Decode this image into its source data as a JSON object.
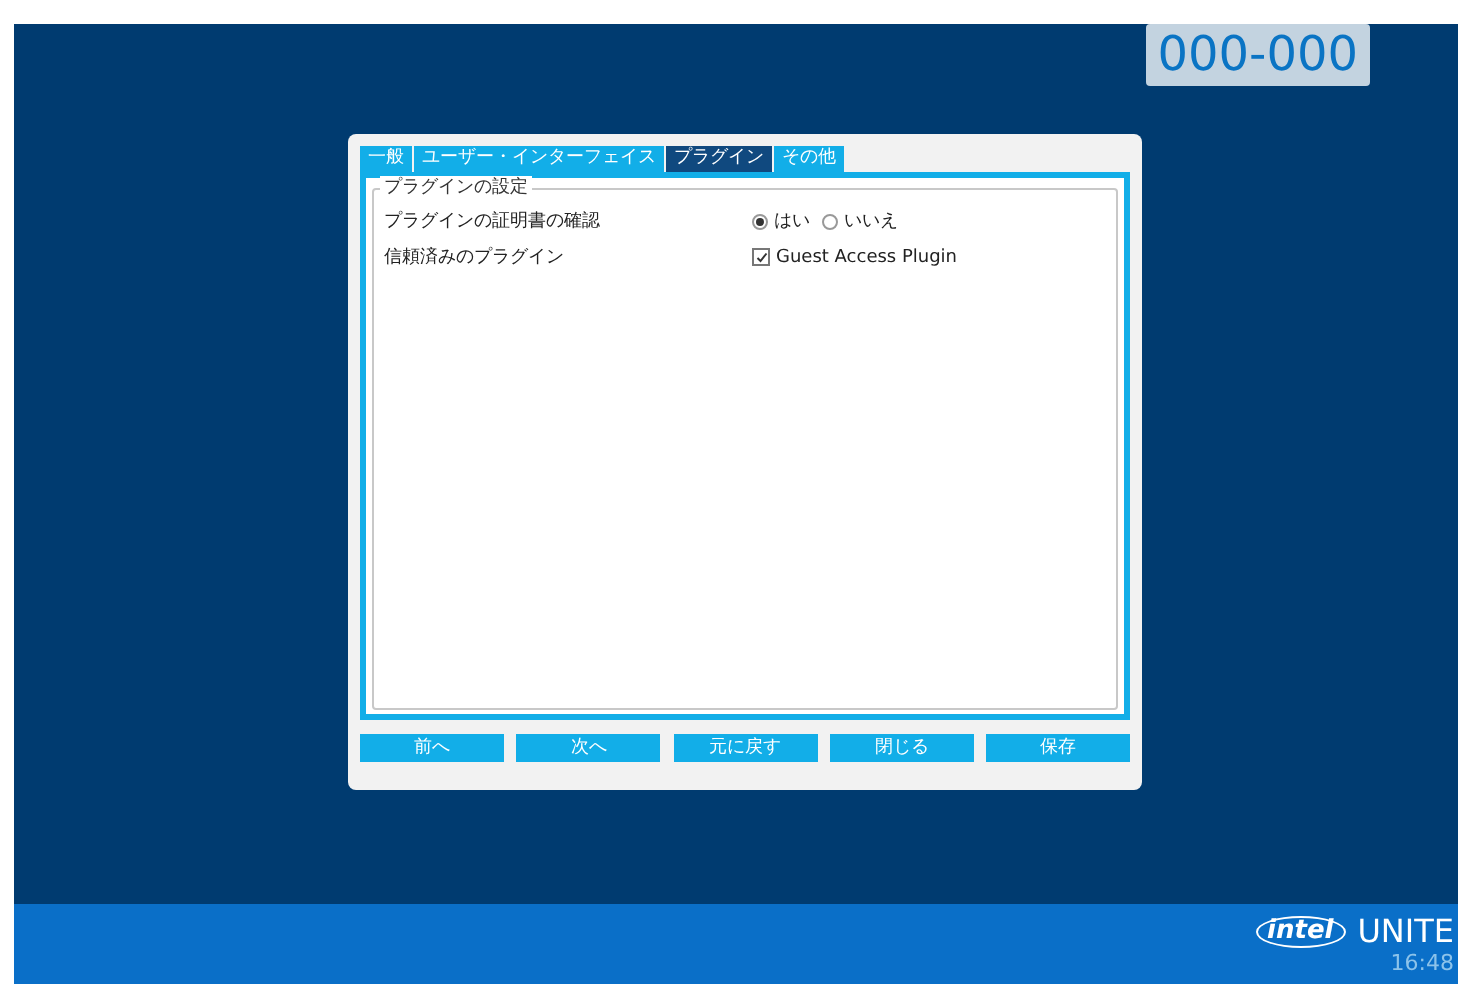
{
  "code": "000-000",
  "tabs": [
    {
      "label": "一般",
      "selected": false
    },
    {
      "label": "ユーザー・インターフェイス",
      "selected": false
    },
    {
      "label": "プラグイン",
      "selected": true
    },
    {
      "label": "その他",
      "selected": false
    }
  ],
  "group": {
    "title": "プラグインの設定",
    "rows": [
      {
        "kind": "radio",
        "label": "プラグインの証明書の確認",
        "options": [
          {
            "label": "はい",
            "selected": true
          },
          {
            "label": "いいえ",
            "selected": false
          }
        ]
      },
      {
        "kind": "checkbox",
        "label": "信頼済みのプラグイン",
        "options": [
          {
            "label": "Guest Access Plugin",
            "checked": true
          }
        ]
      }
    ]
  },
  "buttons": [
    "前へ",
    "次へ",
    "元に戻す",
    "閉じる",
    "保存"
  ],
  "brand": {
    "logo": "intel",
    "name": "UNITE"
  },
  "time": "16:48"
}
